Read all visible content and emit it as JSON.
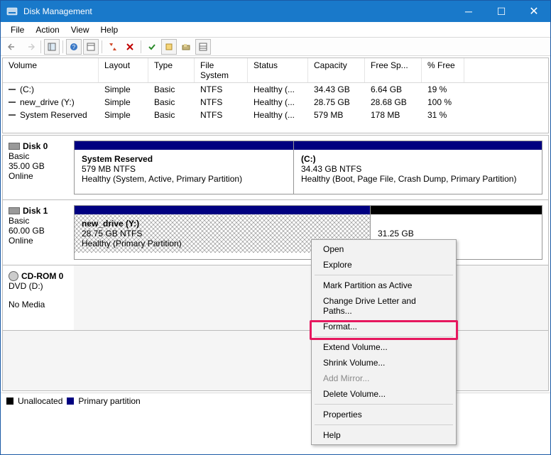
{
  "window": {
    "title": "Disk Management"
  },
  "menu": {
    "file": "File",
    "action": "Action",
    "view": "View",
    "help": "Help"
  },
  "vlist": {
    "headers": {
      "volume": "Volume",
      "layout": "Layout",
      "type": "Type",
      "fs": "File System",
      "status": "Status",
      "capacity": "Capacity",
      "freespace": "Free Sp...",
      "pctfree": "% Free"
    },
    "rows": [
      {
        "volume": "(C:)",
        "layout": "Simple",
        "type": "Basic",
        "fs": "NTFS",
        "status": "Healthy (...",
        "capacity": "34.43 GB",
        "freespace": "6.64 GB",
        "pctfree": "19 %"
      },
      {
        "volume": "new_drive (Y:)",
        "layout": "Simple",
        "type": "Basic",
        "fs": "NTFS",
        "status": "Healthy (...",
        "capacity": "28.75 GB",
        "freespace": "28.68 GB",
        "pctfree": "100 %"
      },
      {
        "volume": "System Reserved",
        "layout": "Simple",
        "type": "Basic",
        "fs": "NTFS",
        "status": "Healthy (...",
        "capacity": "579 MB",
        "freespace": "178 MB",
        "pctfree": "31 %"
      }
    ]
  },
  "disks": {
    "d0": {
      "label": "Disk 0",
      "type": "Basic",
      "size": "35.00 GB",
      "status": "Online",
      "p0": {
        "name": "System Reserved",
        "line2": "579 MB NTFS",
        "line3": "Healthy (System, Active, Primary Partition)"
      },
      "p1": {
        "name": "(C:)",
        "line2": "34.43 GB NTFS",
        "line3": "Healthy (Boot, Page File, Crash Dump, Primary Partition)"
      }
    },
    "d1": {
      "label": "Disk 1",
      "type": "Basic",
      "size": "60.00 GB",
      "status": "Online",
      "p0": {
        "name": "new_drive  (Y:)",
        "line2": "28.75 GB NTFS",
        "line3": "Healthy (Primary Partition)"
      },
      "p1": {
        "size": "31.25 GB"
      }
    },
    "cd": {
      "label": "CD-ROM 0",
      "type": "DVD (D:)",
      "status": "No Media"
    }
  },
  "legend": {
    "unalloc": "Unallocated",
    "primary": "Primary partition"
  },
  "ctx": {
    "open": "Open",
    "explore": "Explore",
    "markactive": "Mark Partition as Active",
    "changeletter": "Change Drive Letter and Paths...",
    "format": "Format...",
    "extend": "Extend Volume...",
    "shrink": "Shrink Volume...",
    "addmirror": "Add Mirror...",
    "delete": "Delete Volume...",
    "properties": "Properties",
    "help": "Help"
  }
}
